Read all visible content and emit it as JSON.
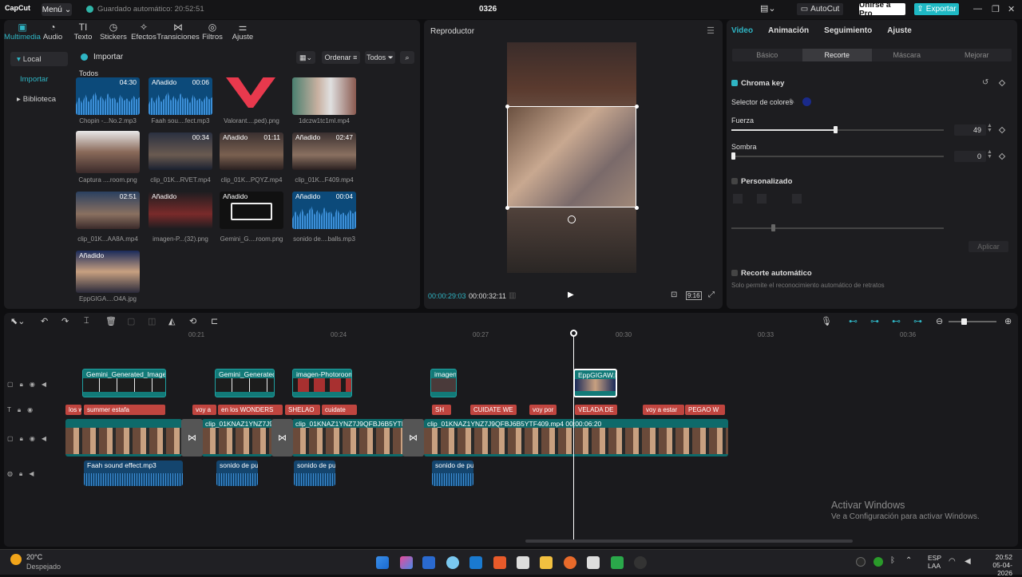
{
  "titlebar": {
    "logo": "CapCut",
    "menu_label": "Menú",
    "autosave": "Guardado automático: 20:52:51",
    "project_title": "0326",
    "autocut_label": "AutoCut",
    "pro_label": "Unirse a Pro",
    "export_label": "Exportar"
  },
  "media": {
    "tools": [
      {
        "label": "Multimedia",
        "icon": "media-icon"
      },
      {
        "label": "Audio",
        "icon": "audio-icon"
      },
      {
        "label": "Texto",
        "icon": "text-icon"
      },
      {
        "label": "Stickers",
        "icon": "sticker-icon"
      },
      {
        "label": "Efectos",
        "icon": "effects-icon"
      },
      {
        "label": "Transiciones",
        "icon": "transition-icon"
      },
      {
        "label": "Filtros",
        "icon": "filter-icon"
      },
      {
        "label": "Ajuste",
        "icon": "adjust-icon"
      }
    ],
    "sidebar": {
      "local": "Local",
      "importar": "Importar",
      "biblioteca": "Biblioteca"
    },
    "import_label": "Importar",
    "sort_label": "Ordenar",
    "filter_label": "Todos",
    "section_label": "Todos",
    "items": [
      {
        "name": "Chopin -...No.2.mp3",
        "tag": "",
        "dur": "04:30"
      },
      {
        "name": "Faah sou....fect.mp3",
        "tag": "Añadido",
        "dur": "00:06"
      },
      {
        "name": "Valorant....ped).png",
        "tag": "",
        "dur": ""
      },
      {
        "name": "1dczw1tc1ml.mp4",
        "tag": "",
        "dur": ""
      },
      {
        "name": "Captura ....room.png",
        "tag": "",
        "dur": ""
      },
      {
        "name": "clip_01K...RVET.mp4",
        "tag": "",
        "dur": "00:34"
      },
      {
        "name": "clip_01K...PQYZ.mp4",
        "tag": "Añadido",
        "dur": "01:11"
      },
      {
        "name": "clip_01K...F409.mp4",
        "tag": "Añadido",
        "dur": "02:47"
      },
      {
        "name": "clip_01K...AA8A.mp4",
        "tag": "",
        "dur": "02:51"
      },
      {
        "name": "imagen-P...(32).png",
        "tag": "Añadido",
        "dur": ""
      },
      {
        "name": "Gemini_G....room.png",
        "tag": "Añadido",
        "dur": ""
      },
      {
        "name": "sonido de....balls.mp3",
        "tag": "Añadido",
        "dur": "00:04"
      },
      {
        "name": "EppGIGA....O4A.jpg",
        "tag": "Añadido",
        "dur": ""
      }
    ]
  },
  "player": {
    "title": "Reproductor",
    "current_time": "00:00:29:03",
    "total_time": "00:00:32:11",
    "ratio": "9:16"
  },
  "props": {
    "tabs": [
      "Video",
      "Animación",
      "Seguimiento",
      "Ajuste"
    ],
    "subtabs": [
      "Básico",
      "Recorte",
      "Máscara",
      "Mejorar"
    ],
    "chroma_key": "Chroma key",
    "color_selector": "Selector de colores",
    "fuerza_label": "Fuerza",
    "fuerza_value": "49",
    "fuerza_level": 0.49,
    "sombra_label": "Sombra",
    "sombra_value": "0",
    "personalizado": "Personalizado",
    "apply_label": "Aplicar",
    "auto_cut": "Recorte automático",
    "auto_note": "Solo permite el reconocimiento automático de retratos"
  },
  "timeline": {
    "ruler": [
      "00:21",
      "00:24",
      "00:27",
      "00:30",
      "00:33",
      "00:36"
    ],
    "image_clips": [
      "Gemini_Generated_Image_y8",
      "Gemini_Generated_I",
      "imagen-Photoroom",
      "imagen-",
      "EppGIGAW.M"
    ],
    "text_clips": [
      "los w",
      "summer estafa",
      "voy a",
      "en los WONDERS",
      "SHELAO",
      "cuidate",
      "SH",
      "CUIDATE WE",
      "voy por",
      "VELADA DE",
      "voy a estar",
      "PEGAO W"
    ],
    "video_clips": [
      "clip_01KNAZ1YNZ7J9QFBJ6B5YTF409.mp4",
      "clip_01KNAZ1YNZ7J9QFBJ6B5YTF409.mp4",
      "clip_01KNAZ1YNZ7J9QFBJ6B5YTF409.mp4  00:00:06:20"
    ],
    "audio_clips": [
      "Faah sound effect.mp3",
      "sonido de pum",
      "sonido de pum",
      "sonido de pum"
    ]
  },
  "watermark": {
    "title": "Activar Windows",
    "subtitle": "Ve a Configuración para activar Windows."
  },
  "taskbar": {
    "weather_temp": "20°C",
    "weather_desc": "Despejado",
    "lang": "ESP",
    "lang2": "LAA",
    "time": "20:52",
    "date": "05-04-2026"
  }
}
